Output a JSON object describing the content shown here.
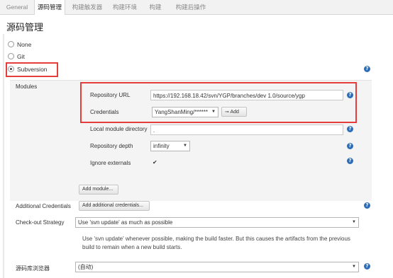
{
  "tabs": [
    {
      "label": "General"
    },
    {
      "label": "源码管理"
    },
    {
      "label": "构建触发器"
    },
    {
      "label": "构建环境"
    },
    {
      "label": "构建"
    },
    {
      "label": "构建后操作"
    }
  ],
  "section_title": "源码管理",
  "scm_options": [
    {
      "label": "None",
      "selected": false
    },
    {
      "label": "Git",
      "selected": false
    },
    {
      "label": "Subversion",
      "selected": true
    }
  ],
  "modules": {
    "label": "Modules",
    "repository_url_label": "Repository URL",
    "repository_url_value": "https://192.168.18.42/svn/YGP/branches/dev 1.0/source/ygp",
    "credentials_label": "Credentials",
    "credentials_value": "YangShanMing/******",
    "add_button": "Add",
    "local_module_label": "Local module directory",
    "local_module_value": ".",
    "depth_label": "Repository depth",
    "depth_value": "infinity",
    "ignore_externals_label": "Ignore externals",
    "ignore_externals_checked": true,
    "add_module_button": "Add module..."
  },
  "additional_credentials": {
    "label": "Additional Credentials",
    "button": "Add additional credentials..."
  },
  "checkout_strategy": {
    "label": "Check-out Strategy",
    "value": "Use 'svn update' as much as possible",
    "description_line1": "Use 'svn update' whenever possible, making the build faster. But this causes the artifacts from the previous",
    "description_line2": "build to remain when a new build starts."
  },
  "repo_browser": {
    "label": "源码库浏览器",
    "value": "(自动)"
  },
  "help_glyph": "?",
  "accent_color": "#e53c3c"
}
